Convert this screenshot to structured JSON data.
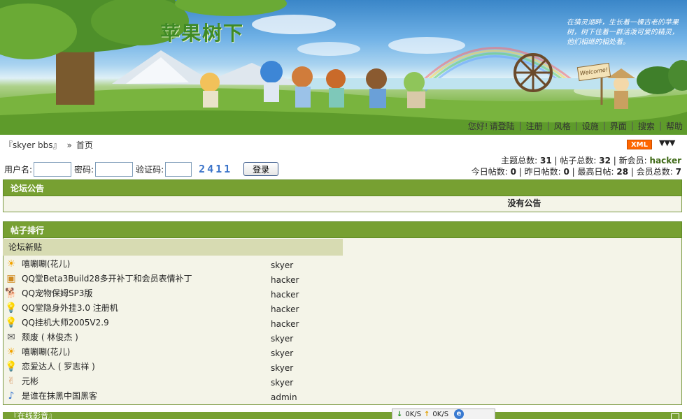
{
  "banner": {
    "site_title": "苹果树下",
    "slogan": "在猜灵湖畔，生长着一棵古老的苹果树，树下住着一群活泼可爱的精灵，他们相继的相处着。",
    "welcome_sign": "Welcome!"
  },
  "topnav": {
    "greeting": "您好!",
    "items": [
      "请登陆",
      "注册",
      "风格",
      "设施",
      "界面",
      "搜索",
      "帮助"
    ]
  },
  "breadcrumb": {
    "forum": "『skyer bbs』",
    "separator": "»",
    "current": "首页"
  },
  "xml_badge": "XML",
  "collapse_arrows": "▼▼▼",
  "login": {
    "username_label": "用户名:",
    "password_label": "密码:",
    "captcha_label": "验证码:",
    "captcha_text": "2411",
    "username_value": "",
    "password_value": "",
    "captcha_value": "",
    "button": "登录"
  },
  "stats": {
    "topics_label": "主题总数:",
    "topics": "31",
    "posts_label": "帖子总数:",
    "posts": "32",
    "new_member_label": "新会员:",
    "new_member": "hacker",
    "today_label": "今日帖数:",
    "today": "0",
    "yesterday_label": "昨日帖数:",
    "yesterday": "0",
    "max_label": "最高日帖:",
    "max": "28",
    "members_label": "会员总数:",
    "members": "7"
  },
  "notice": {
    "title": "论坛公告",
    "text": "没有公告"
  },
  "ranking": {
    "title": "帖子排行",
    "subhead": "论坛新贴",
    "posts": [
      {
        "icon": "sun-icon",
        "glyph": "☀",
        "color": "#f2a300",
        "title": "嘻唰唰(花儿)",
        "author": "skyer"
      },
      {
        "icon": "package-icon",
        "glyph": "▣",
        "color": "#d08a20",
        "title": "QQ堂Beta3Build28多开补丁和会员表情补丁",
        "author": "hacker"
      },
      {
        "icon": "dog-icon",
        "glyph": "🐕",
        "color": "#b8732a",
        "title": "QQ宠物保姆SP3版",
        "author": "hacker"
      },
      {
        "icon": "lightbulb-icon",
        "glyph": "💡",
        "color": "#f5c400",
        "title": "QQ堂隐身外挂3.0 注册机",
        "author": "hacker"
      },
      {
        "icon": "lightbulb-icon",
        "glyph": "💡",
        "color": "#f5c400",
        "title": "QQ挂机大师2005V2.9",
        "author": "hacker"
      },
      {
        "icon": "envelope-icon",
        "glyph": "✉",
        "color": "#555555",
        "title": "颓废 ( 林俊杰 )",
        "author": "skyer"
      },
      {
        "icon": "sun-icon",
        "glyph": "☀",
        "color": "#f2a300",
        "title": "嘻唰唰(花儿)",
        "author": "skyer"
      },
      {
        "icon": "lightbulb-icon",
        "glyph": "💡",
        "color": "#f5c400",
        "title": "恋爱达人 ( 罗志祥 )",
        "author": "skyer"
      },
      {
        "icon": "peace-hand-icon",
        "glyph": "✌",
        "color": "#d9a070",
        "title": "元彬",
        "author": "skyer"
      },
      {
        "icon": "music-note-icon",
        "glyph": "♪",
        "color": "#2f6fcf",
        "title": "是谁在抹黑中国黑客",
        "author": "admin"
      }
    ]
  },
  "bottom": {
    "title": "『在线影音』"
  },
  "netspeed": {
    "down": "0K/S",
    "up": "0K/S",
    "ie": "e"
  }
}
